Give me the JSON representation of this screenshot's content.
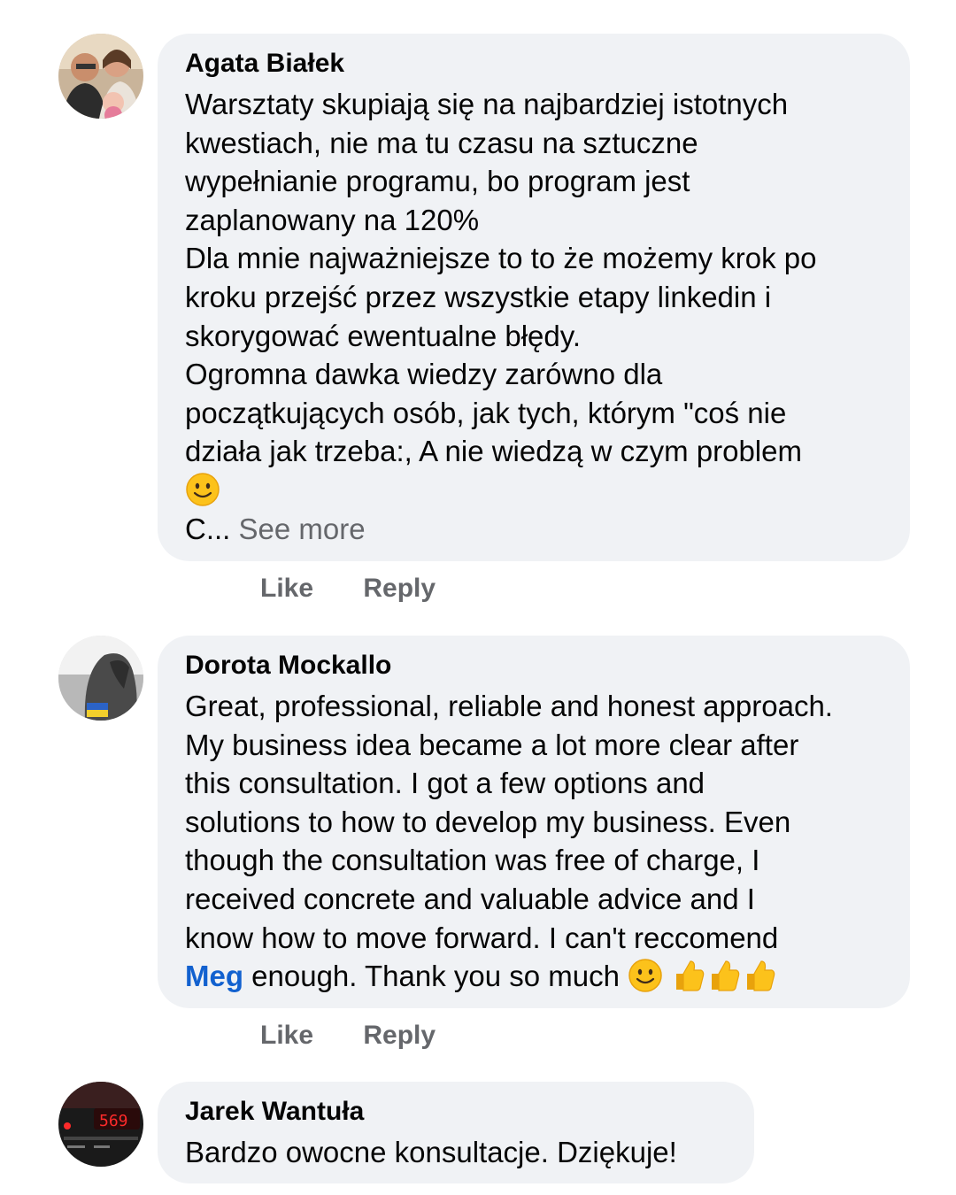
{
  "comments": [
    {
      "author": "Agata Białek",
      "lines": [
        "Warsztaty skupiają się na najbardziej istotnych",
        "kwestiach, nie ma tu czasu na sztuczne",
        "wypełnianie programu, bo program jest",
        "zaplanowany na 120%",
        "Dla mnie najważniejsze to to że możemy krok po",
        "kroku przejść przez wszystkie etapy linkedin i",
        "skorygować ewentualne błędy.",
        "Ogromna dawka wiedzy zarówno dla",
        "początkujących osób, jak tych, którym \"coś nie",
        "działa jak trzeba:, A nie wiedzą w czym problem"
      ],
      "truncated_text": "C...",
      "see_more_label": "See more",
      "like_label": "Like",
      "reply_label": "Reply"
    },
    {
      "author": "Dorota Mockallo",
      "lines": [
        "Great, professional, reliable and honest approach.",
        "My business idea became a lot more clear after",
        "this consultation. I got a few options and",
        "solutions to how to develop my business. Even",
        "though the consultation was free of charge, I",
        "received concrete and valuable  advice and I",
        "know how to move forward. I can't reccomend"
      ],
      "mention": "Meg",
      "last_line_text": " enough. Thank you so much ",
      "like_label": "Like",
      "reply_label": "Reply"
    },
    {
      "author": "Jarek Wantuła",
      "lines": [
        "Bardzo owocne konsultacje. Dziękuje!"
      ]
    }
  ],
  "icons": {
    "smile": "slightly-smiling-face-emoji",
    "thumbs_up": "thumbs-up-emoji"
  },
  "colors": {
    "bubble": "#f0f2f5",
    "secondary_text": "#65676b",
    "mention": "#1261cf"
  }
}
